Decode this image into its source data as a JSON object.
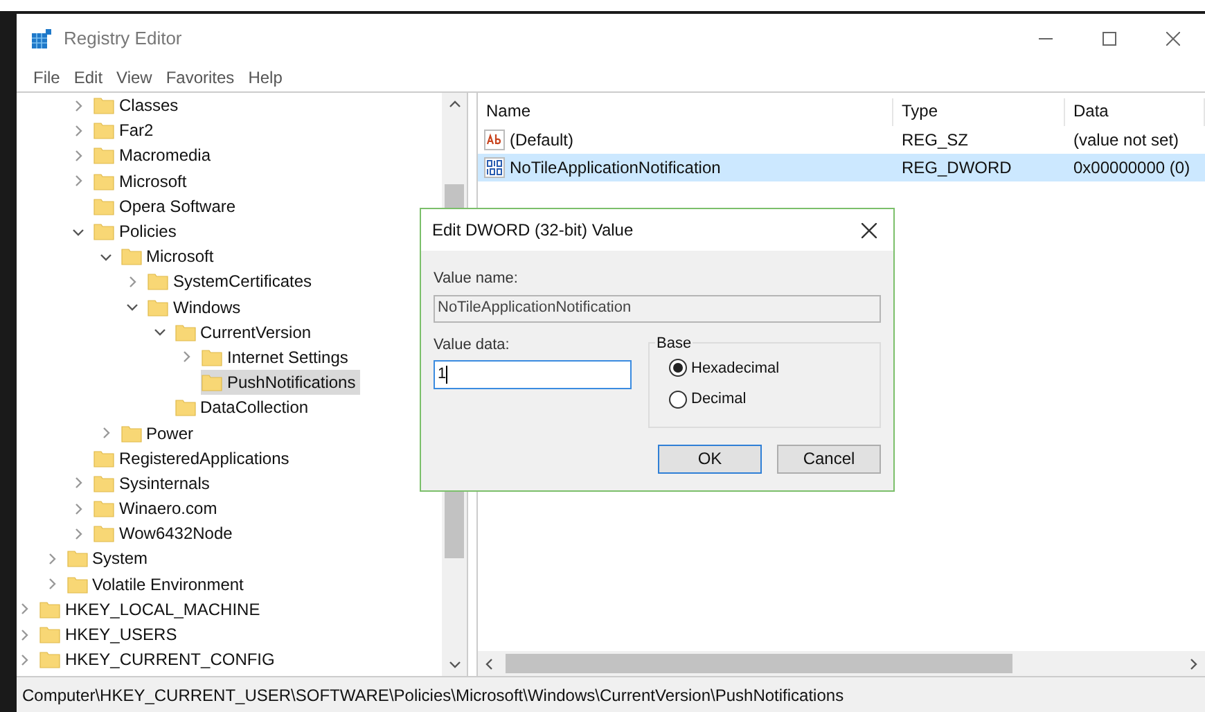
{
  "window": {
    "title": "Registry Editor"
  },
  "menu": [
    "File",
    "Edit",
    "View",
    "Favorites",
    "Help"
  ],
  "tree": [
    {
      "kind": "hidden",
      "children": [
        {
          "kind": "hidden",
          "children": [
            {
              "kind": "branch",
              "label": "Classes",
              "expanded": false,
              "selected": false
            },
            {
              "kind": "branch",
              "label": "Far2",
              "expanded": false,
              "selected": false
            },
            {
              "kind": "branch",
              "label": "Macromedia",
              "expanded": false,
              "selected": false
            },
            {
              "kind": "branch",
              "label": "Microsoft",
              "expanded": false,
              "selected": false
            },
            {
              "kind": "leaf",
              "label": "Opera Software",
              "selected": false
            },
            {
              "kind": "branch",
              "label": "Policies",
              "expanded": true,
              "selected": false,
              "children": [
                {
                  "kind": "branch",
                  "label": "Microsoft",
                  "expanded": true,
                  "selected": false,
                  "children": [
                    {
                      "kind": "branch",
                      "label": "SystemCertificates",
                      "expanded": false,
                      "selected": false
                    },
                    {
                      "kind": "branch",
                      "label": "Windows",
                      "expanded": true,
                      "selected": false,
                      "children": [
                        {
                          "kind": "branch",
                          "label": "CurrentVersion",
                          "expanded": true,
                          "selected": false,
                          "children": [
                            {
                              "kind": "branch",
                              "label": "Internet Settings",
                              "expanded": false,
                              "selected": false
                            },
                            {
                              "kind": "leaf",
                              "label": "PushNotifications",
                              "selected": true
                            }
                          ]
                        },
                        {
                          "kind": "leaf",
                          "label": "DataCollection",
                          "selected": false
                        }
                      ]
                    }
                  ]
                },
                {
                  "kind": "branch",
                  "label": "Power",
                  "expanded": false,
                  "selected": false
                }
              ]
            },
            {
              "kind": "leaf",
              "label": "RegisteredApplications",
              "selected": false
            },
            {
              "kind": "branch",
              "label": "Sysinternals",
              "expanded": false,
              "selected": false
            },
            {
              "kind": "branch",
              "label": "Winaero.com",
              "expanded": false,
              "selected": false
            },
            {
              "kind": "branch",
              "label": "Wow6432Node",
              "expanded": false,
              "selected": false
            }
          ]
        },
        {
          "kind": "branch",
          "label": "System",
          "expanded": false,
          "selected": false
        },
        {
          "kind": "branch",
          "label": "Volatile Environment",
          "expanded": false,
          "selected": false
        }
      ]
    },
    {
      "kind": "branch",
      "label": "HKEY_LOCAL_MACHINE",
      "expanded": false,
      "selected": false
    },
    {
      "kind": "branch",
      "label": "HKEY_USERS",
      "expanded": false,
      "selected": false
    },
    {
      "kind": "branch",
      "label": "HKEY_CURRENT_CONFIG",
      "expanded": false,
      "selected": false
    }
  ],
  "values": {
    "columns": [
      "Name",
      "Type",
      "Data"
    ],
    "rows": [
      {
        "kind": "string",
        "name": "(Default)",
        "type": "REG_SZ",
        "data": "(value not set)",
        "selected": false
      },
      {
        "kind": "dword",
        "name": "NoTileApplicationNotification",
        "type": "REG_DWORD",
        "data": "0x00000000 (0)",
        "selected": true
      }
    ]
  },
  "dialog": {
    "title": "Edit DWORD (32-bit) Value",
    "value_name_label": "Value name:",
    "value_name": "NoTileApplicationNotification",
    "value_data_label": "Value data:",
    "value_data": "1",
    "base": {
      "label": "Base",
      "options": [
        {
          "label": "Hexadecimal",
          "selected": true
        },
        {
          "label": "Decimal",
          "selected": false
        }
      ]
    },
    "buttons": [
      {
        "label": "OK",
        "default": true
      },
      {
        "label": "Cancel",
        "default": false
      }
    ]
  },
  "status_bar": "Computer\\HKEY_CURRENT_USER\\SOFTWARE\\Policies\\Microsoft\\Windows\\CurrentVersion\\PushNotifications"
}
